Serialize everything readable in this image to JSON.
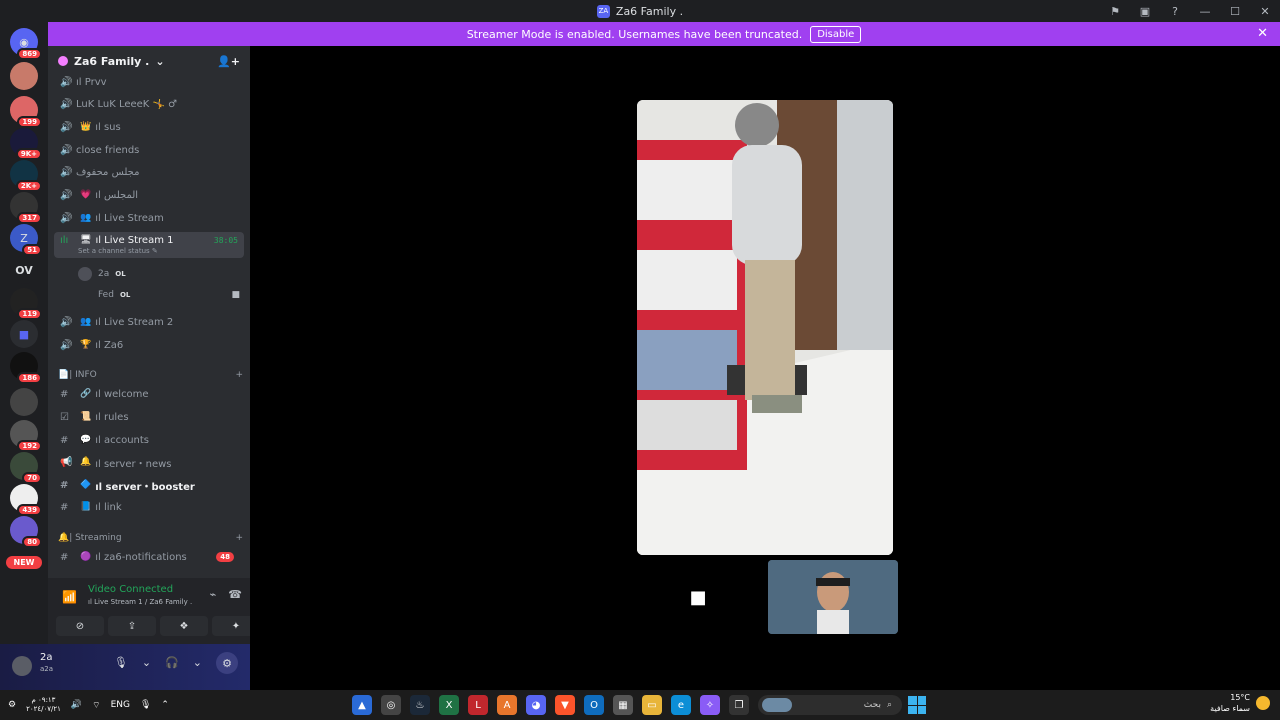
{
  "window": {
    "title": "Za6 Family .",
    "app_icon": "ZA"
  },
  "banner": {
    "text": "Streamer Mode is enabled. Usernames have been truncated.",
    "disable_label": "Disable"
  },
  "guilds": {
    "badges": [
      "869",
      "199",
      "9K+",
      "2K+",
      "317",
      "51",
      "119",
      "186",
      "192",
      "70",
      "439",
      "80"
    ],
    "ov_label": "OV",
    "new_label": "NEW"
  },
  "server": {
    "name": "Za6 Family ."
  },
  "channels": [
    {
      "name": "ıl Prvv"
    },
    {
      "name": "LuK LuK LeeeK 🤸 ♂"
    },
    {
      "name": "ıl sus"
    },
    {
      "name": "close friends"
    },
    {
      "name": "مجلس محفوف"
    },
    {
      "name": "ıl المجلس"
    },
    {
      "name": "ıl Live Stream"
    },
    {
      "name": "ıl Live Stream 1",
      "timer": "38:05",
      "status": "Set a channel status ✎"
    },
    {
      "name": "ıl Live Stream 2"
    },
    {
      "name": "ıl Za6"
    }
  ],
  "members": [
    {
      "name": "2a",
      "tag": "OL"
    },
    {
      "name": "Fed",
      "tag": "OL"
    }
  ],
  "info_category": {
    "label": "📄| INFO",
    "channels": [
      "ıl welcome",
      "ıl rules",
      "ıl accounts",
      "ıl server・news",
      "ıl server・booster",
      "ıl link"
    ]
  },
  "streaming_category": {
    "label": "🔔| Streaming",
    "channels": [
      {
        "name": "ıl za6-notifications",
        "count": "48"
      }
    ]
  },
  "voice": {
    "title": "Video Connected",
    "subtitle": "ıl Live Stream 1 / Za6 Family ."
  },
  "user": {
    "name": "2a",
    "status": "a2a"
  },
  "taskbar": {
    "lang": "ENG",
    "time": "٠٩:١٣ م",
    "date": "٢٠٢٤/٠٧/٢١",
    "search_placeholder": "بحث",
    "temp": "15°C",
    "weather": "سماء صافية"
  },
  "colors": {
    "accent": "#a040f0",
    "voice_green": "#23a55a",
    "badge_red": "#f23f43"
  }
}
